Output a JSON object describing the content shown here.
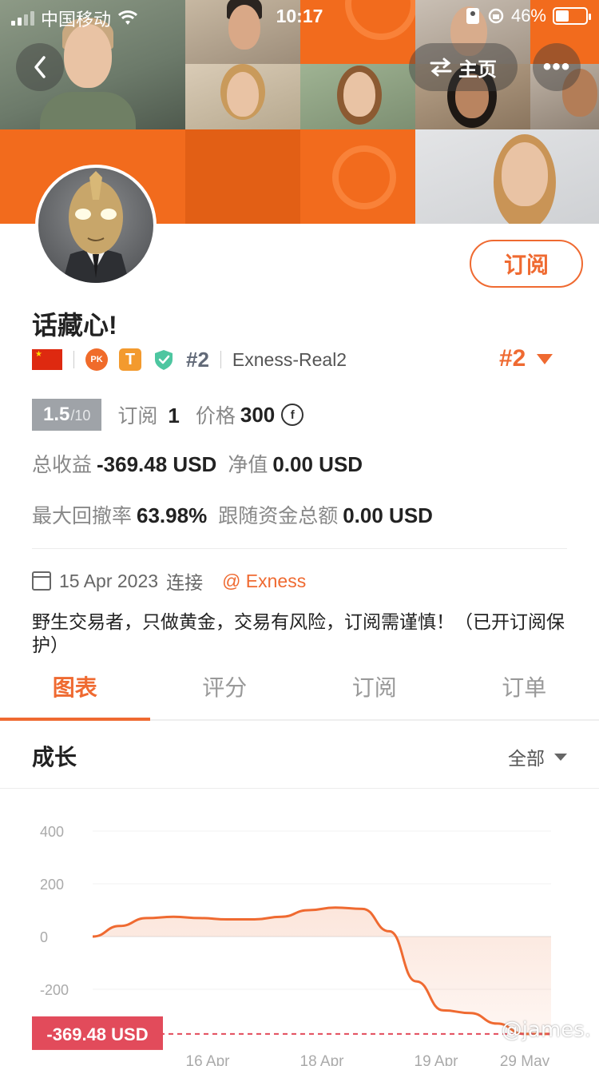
{
  "status_bar": {
    "carrier": "中国移动",
    "time": "10:17",
    "battery": "46%"
  },
  "header": {
    "home_label": "主页",
    "more_label": "•••"
  },
  "profile": {
    "subscribe_label": "订阅",
    "name": "话藏心!",
    "pk_badge": "PK",
    "t_badge": "T",
    "rank_small": "#2",
    "account": "Exness-Real2",
    "rank_big": "#2"
  },
  "stats": {
    "score": "1.5",
    "score_total": "/10",
    "subscribe_label": "订阅",
    "subscribe_count": "1",
    "price_label": "价格",
    "price": "300",
    "coin_symbol": "f",
    "total_profit_label": "总收益",
    "total_profit": "-369.48 USD",
    "equity_label": "净值",
    "equity": "0.00 USD",
    "max_drawdown_label": "最大回撤率",
    "max_drawdown": "63.98%",
    "follow_total_label": "跟随资金总额",
    "follow_total": "0.00 USD"
  },
  "connection": {
    "date": "15 Apr 2023",
    "connected_label": "连接",
    "broker": "@ Exness"
  },
  "bio": "野生交易者，只做黄金，交易有风险，订阅需谨慎！（已开订阅保护）",
  "tabs": [
    {
      "label": "图表",
      "active": true
    },
    {
      "label": "评分",
      "active": false
    },
    {
      "label": "订阅",
      "active": false
    },
    {
      "label": "订单",
      "active": false
    }
  ],
  "section": {
    "title": "成长",
    "filter": "全部"
  },
  "chart_data": {
    "type": "area",
    "y_ticks": [
      400,
      200,
      0,
      -200
    ],
    "ylim": [
      -400,
      400
    ],
    "x_ticks": [
      "16 Apr",
      "18 Apr",
      "19 Apr",
      "29 May"
    ],
    "series": [
      {
        "values": [
          0,
          40,
          70,
          75,
          70,
          65,
          65,
          75,
          100,
          110,
          105,
          20,
          -170,
          -280,
          -290,
          -330,
          -369.48,
          -369.48
        ]
      }
    ],
    "current_label": "-369.48 USD",
    "line_color": "#ef6a31"
  },
  "watermark": "@james."
}
